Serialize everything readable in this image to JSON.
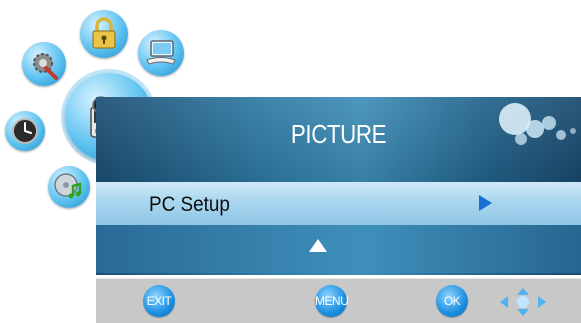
{
  "menu": {
    "title": "PICTURE",
    "selected_item": "PC Setup"
  },
  "footer": {
    "exit_label": "EXIT",
    "menu_label": "MENU",
    "ok_label": "OK"
  },
  "icons": [
    "lock-icon",
    "monitor-icon",
    "settings-icon",
    "camcorder-icon",
    "clock-icon",
    "music-cd-icon"
  ],
  "colors": {
    "panel": "#2f7ba5",
    "selected_row": "#a9d6ef",
    "accent_arrow": "#1a6fd4",
    "button_blue": "#1b8fe0",
    "footer": "#c8c8c8"
  }
}
